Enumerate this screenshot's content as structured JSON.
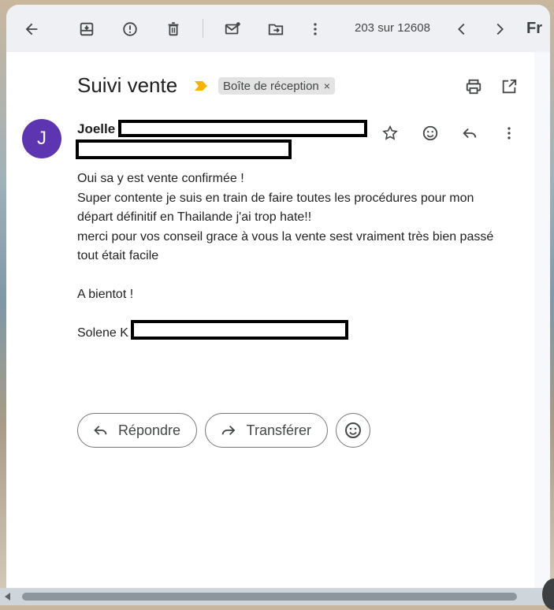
{
  "toolbar": {
    "counter": "203 sur 12608",
    "logo_text": "Fr"
  },
  "email": {
    "subject": "Suivi vente",
    "label": "Boîte de réception",
    "label_close": "×",
    "avatar_letter": "J",
    "sender": "Joelle",
    "body_lines": [
      "Oui sa y est vente confirmée !",
      "Super contente je suis en train de faire toutes les procédures pour mon",
      "départ définitif en Thailande j'ai trop hate!!",
      "merci pour vos conseil grace à vous la vente sest vraiment très bien passé",
      "tout était facile"
    ],
    "closing": "A bientot !",
    "signature": "Solene K"
  },
  "actions": {
    "reply_label": "Répondre",
    "forward_label": "Transférer"
  },
  "colors": {
    "avatar": "#5e35b1",
    "important_marker": "#f4b400"
  }
}
